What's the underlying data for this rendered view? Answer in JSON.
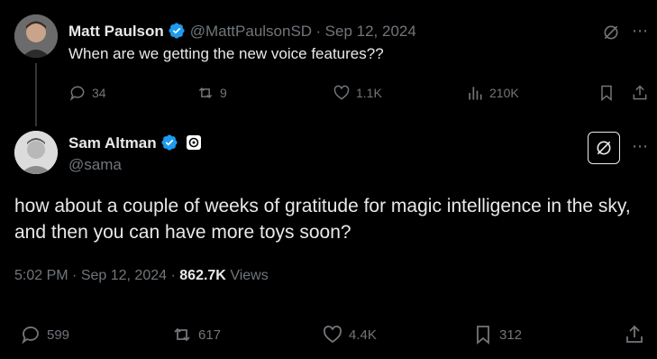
{
  "reply_to": {
    "name": "Matt Paulson",
    "handle": "@MattPaulsonSD",
    "date": "Sep 12, 2024",
    "text": "When are we getting the new voice features??",
    "actions": {
      "replies": "34",
      "reposts": "9",
      "likes": "1.1K",
      "views": "210K"
    }
  },
  "tweet": {
    "name": "Sam Altman",
    "handle": "@sama",
    "text": "how about a couple of weeks of gratitude for magic intelligence in the sky, and then you can have more toys soon?",
    "time": "5:02 PM",
    "date": "Sep 12, 2024",
    "views_count": "862.7K",
    "views_label": "Views",
    "actions": {
      "replies": "599",
      "reposts": "617",
      "likes": "4.4K",
      "bookmarks": "312"
    }
  },
  "colors": {
    "verified": "#1d9bf0",
    "text": "#e7e9ea",
    "muted": "#71767b",
    "background": "#000000"
  }
}
